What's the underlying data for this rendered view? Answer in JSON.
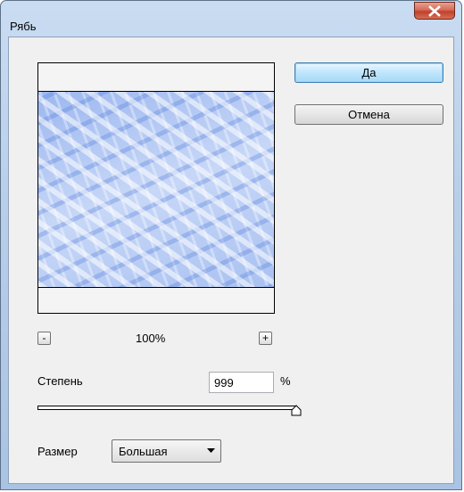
{
  "window": {
    "title": "Рябь"
  },
  "buttons": {
    "ok": "Да",
    "cancel": "Отмена"
  },
  "preview": {
    "zoom": "100%",
    "zoom_out": "-",
    "zoom_in": "+"
  },
  "amount": {
    "label": "Степень",
    "value": "999",
    "unit": "%",
    "slider_fraction": 1.0
  },
  "size": {
    "label": "Размер",
    "value": "Большая"
  },
  "icons": {
    "close": "close-icon",
    "dropdown": "chevron-down-icon"
  },
  "colors": {
    "accent": "#3c7fb1",
    "close": "#c1402c"
  }
}
